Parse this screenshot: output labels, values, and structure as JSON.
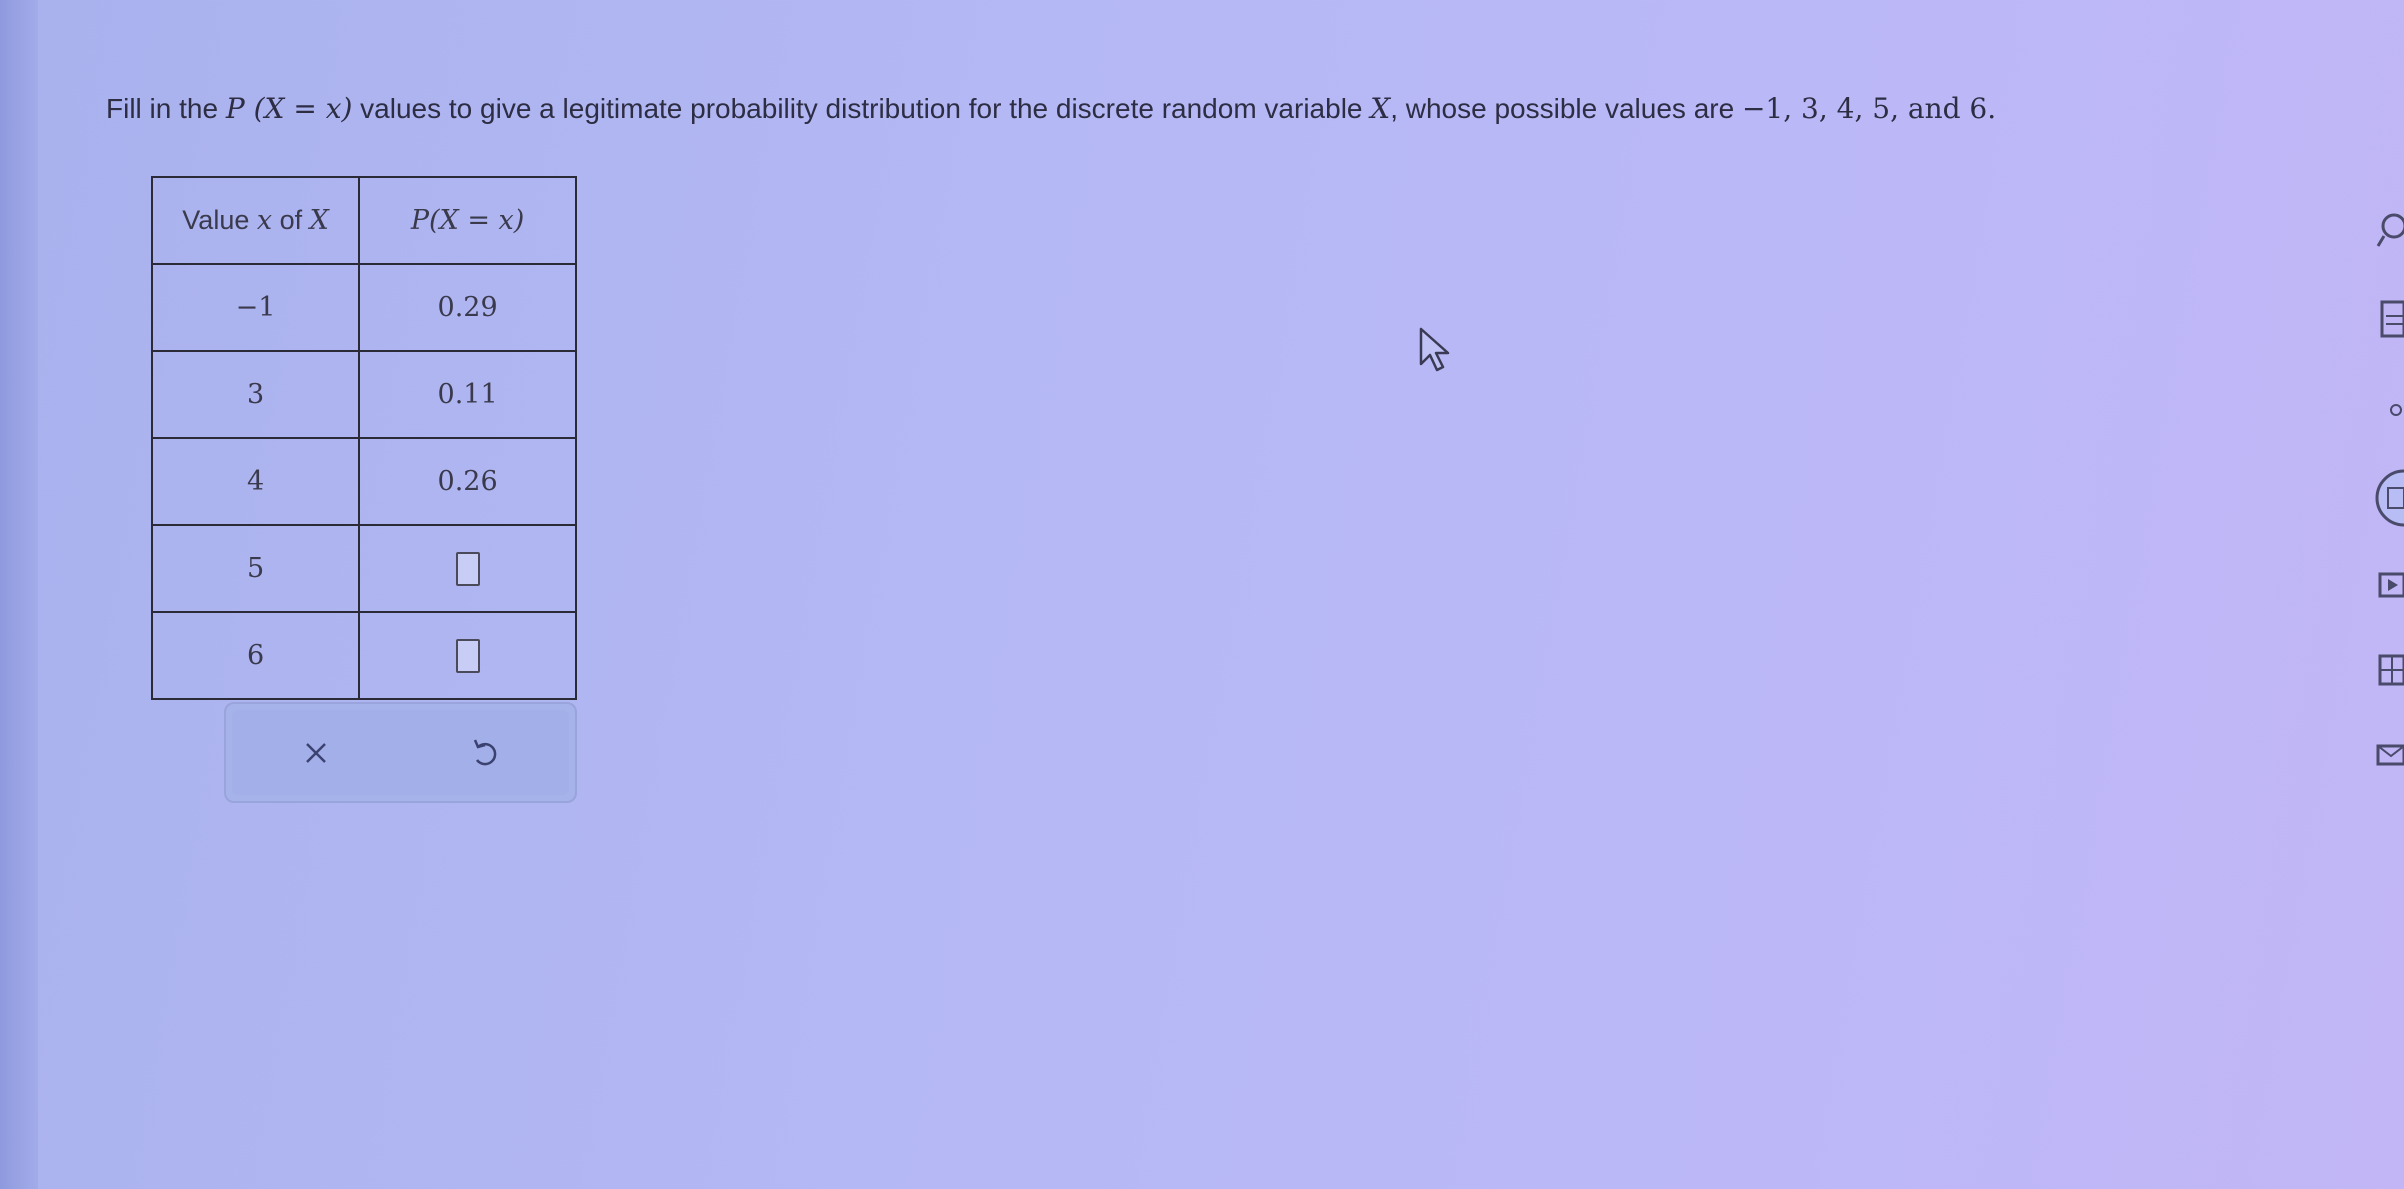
{
  "question": {
    "text_before": "Fill in the ",
    "p_expr": "P (X = x)",
    "text_middle": " values to give a legitimate probability distribution for the discrete random variable ",
    "var": "X",
    "text_after": ", whose possible values are ",
    "values_list": "−1, 3, 4, 5, and 6."
  },
  "table": {
    "header_left_prefix": "Value ",
    "header_left_x": "x",
    "header_left_of": " of ",
    "header_left_X": "X",
    "header_right": "P(X = x)",
    "rows": [
      {
        "x": "−1",
        "p": "0.29"
      },
      {
        "x": "3",
        "p": "0.11"
      },
      {
        "x": "4",
        "p": "0.26"
      },
      {
        "x": "5",
        "p": ""
      },
      {
        "x": "6",
        "p": ""
      }
    ]
  },
  "buttons": {
    "clear_icon": "x-icon",
    "undo_icon": "undo-icon"
  },
  "colors": {
    "background": "#b4b8f4",
    "button_bar": "#a6b2ea",
    "text": "#2d2d44"
  }
}
